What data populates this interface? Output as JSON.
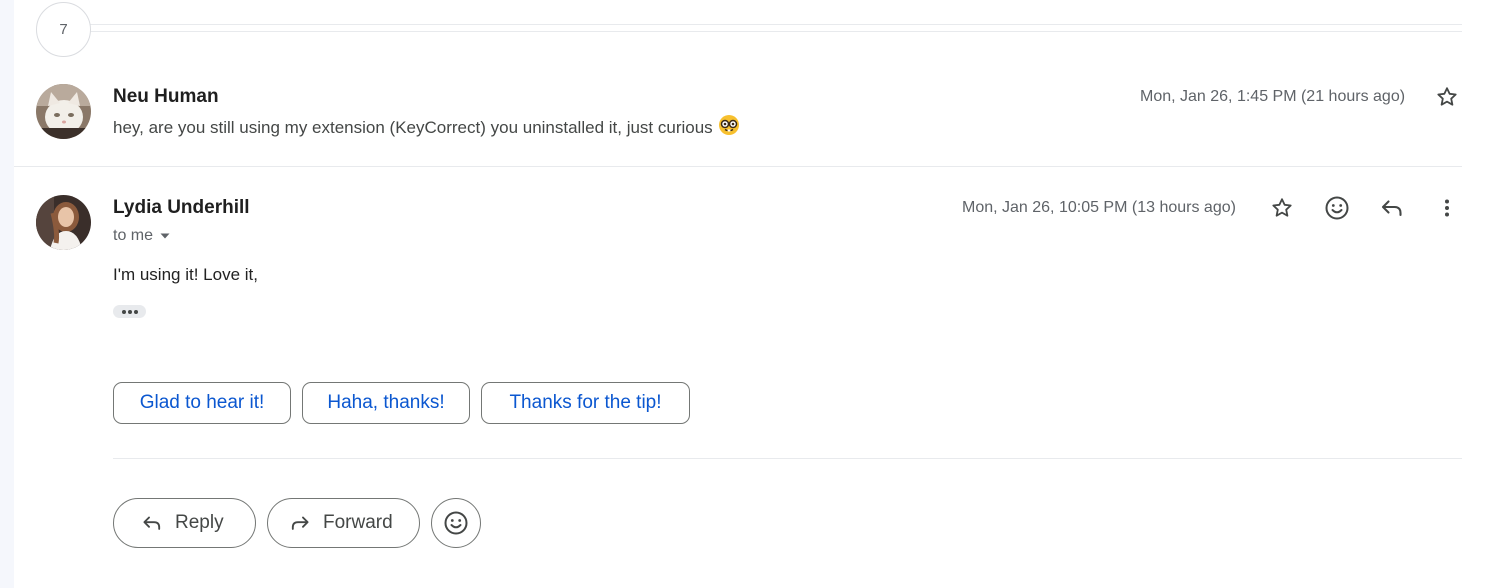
{
  "collapsed_count": "7",
  "messages": [
    {
      "sender": "Neu Human",
      "snippet": "hey, are you still using my extension (KeyCorrect) you uninstalled it, just curious",
      "snippet_emoji": "🤓",
      "date": "Mon, Jan 26, 1:45 PM (21 hours ago)",
      "avatar_icon": "cat-photo-avatar"
    },
    {
      "sender": "Lydia Underhill",
      "recipient": "to me",
      "date": "Mon, Jan 26, 10:05 PM (13 hours ago)",
      "body": "I'm using it! Love it,",
      "avatar_icon": "person-photo-avatar"
    }
  ],
  "smart_replies": [
    "Glad to hear it!",
    "Haha, thanks!",
    "Thanks for the tip!"
  ],
  "actions": {
    "reply": "Reply",
    "forward": "Forward"
  },
  "colors": {
    "accent_blue": "#0b57d0",
    "text_secondary": "#5f6368",
    "border": "#747775"
  },
  "icons": [
    "star-icon",
    "emoji-react-icon",
    "reply-icon",
    "more-vert-icon",
    "forward-icon",
    "dropdown-caret-icon"
  ]
}
